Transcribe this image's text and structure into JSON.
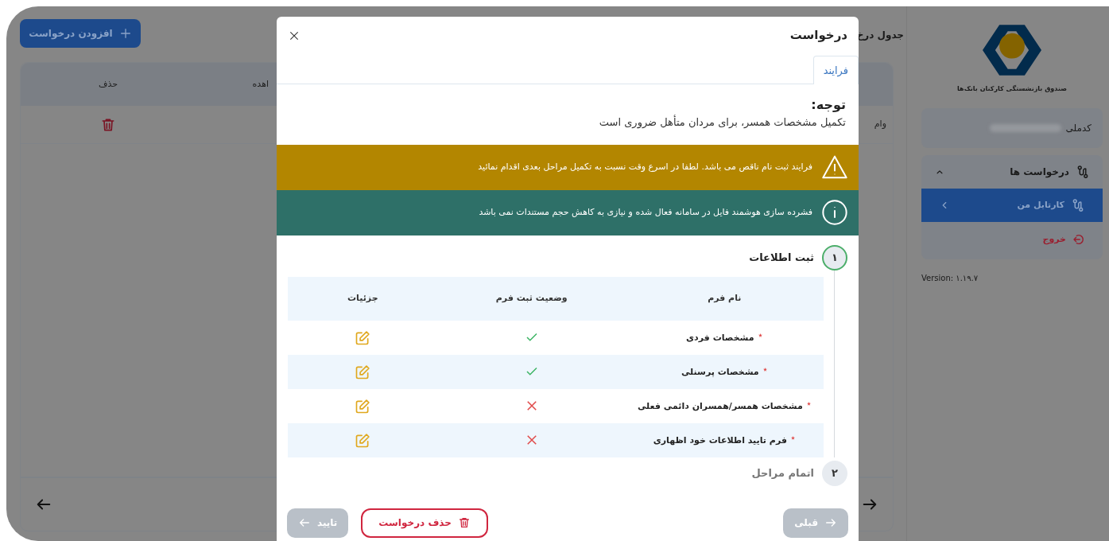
{
  "background_page": {
    "add_button": "افزودن درخواست",
    "table_title": "جدول درخ",
    "columns": [
      "اهده",
      "حذف"
    ],
    "rows": [
      {
        "title_cell": "وام"
      }
    ]
  },
  "sidebar": {
    "logo_caption": "صندوق بازنشستگی کارکنان بانک‌ها",
    "national_code_label": "کدملی",
    "menu": [
      {
        "label": "درخواست ها",
        "kind": "group",
        "expanded": true,
        "children": [
          {
            "label": "کارتابل من",
            "selected": true
          }
        ]
      },
      {
        "label": "خروج",
        "kind": "logout"
      }
    ],
    "version": "Version: ۱.۱۹.۷"
  },
  "dialog": {
    "title": "درخواست",
    "tabs": [
      {
        "label": "فرایند",
        "selected": true
      }
    ],
    "notice_title": "توجه:",
    "notice_text": "تکمیل مشخصات همسر، برای مردان متأهل ضروری است",
    "alerts": [
      {
        "kind": "warning",
        "text": "فرایند ثبت نام ناقص می باشد. لطفا در اسرع وقت نسبت به تکمیل مراحل بعدی اقدام نمائید"
      },
      {
        "kind": "info",
        "text": "فشرده سازی هوشمند فایل در سامانه فعال شده و نیازی به کاهش حجم مستندات نمی باشد"
      }
    ],
    "steps": [
      {
        "number": "۱",
        "title": "ثبت اطلاعات",
        "active": true,
        "table": {
          "columns": [
            "نام فرم",
            "وضعیت ثبت فرم",
            "جزئیات"
          ],
          "rows": [
            {
              "name": "مشخصات فردی",
              "required": true,
              "completed": true
            },
            {
              "name": "مشخصات پرسنلی",
              "required": true,
              "completed": true
            },
            {
              "name": "مشخصات همسر/همسران دائمی فعلی",
              "required": true,
              "completed": false
            },
            {
              "name": "فرم تایید اطلاعات خود اظهاری",
              "required": true,
              "completed": false
            }
          ]
        }
      },
      {
        "number": "۲",
        "title": "اتمام مراحل",
        "active": false
      }
    ],
    "buttons": [
      {
        "kind": "previous",
        "label": "قبلی",
        "disabled": true
      },
      {
        "kind": "delete",
        "label": "حذف درخواست",
        "disabled": false
      },
      {
        "kind": "confirm",
        "label": "تایید",
        "disabled": true
      }
    ]
  }
}
